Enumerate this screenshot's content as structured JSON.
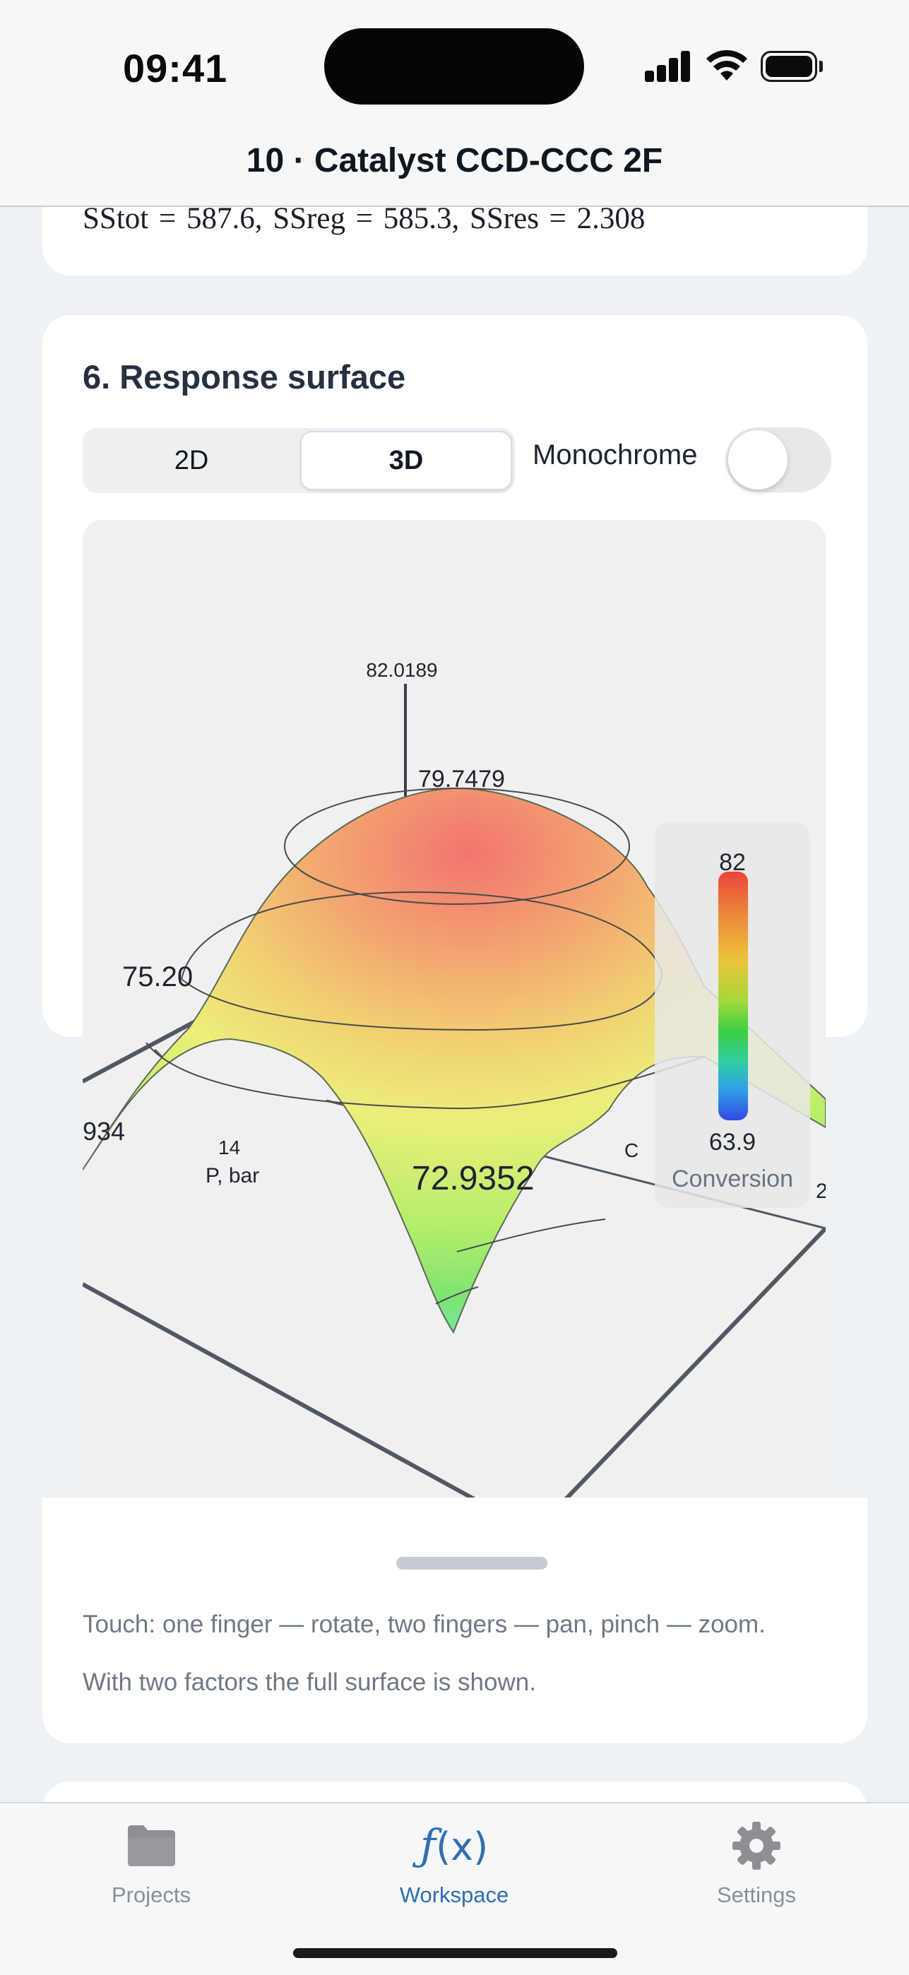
{
  "status_bar": {
    "time": "09:41"
  },
  "nav": {
    "title": "10 · Catalyst CCD-CCC 2F"
  },
  "previous_card": {
    "ss_line": "SStot = 587.6,  SSreg = 585.3,  SSres = 2.308"
  },
  "response_surface": {
    "title": "6. Response surface",
    "segments": [
      "2D",
      "3D"
    ],
    "selected_segment": "3D",
    "monochrome_label": "Monochrome",
    "monochrome_on": false,
    "axis_labels": {
      "z_top": "82.0189",
      "z_mid": "79.7479",
      "z_side": "75.20",
      "x_left": "934",
      "p_tick": "14",
      "p_axis": "P, bar",
      "center_value": "72.9352",
      "c_label": "C",
      "right_edge": "2"
    },
    "legend": {
      "max": "82",
      "min": "63.9",
      "title": "Conversion"
    },
    "hints": [
      "Touch: one finger — rotate, two fingers — pan, pinch — zoom.",
      "With two factors the full surface is shown."
    ]
  },
  "tabs": [
    {
      "label": "Projects",
      "icon": "folder-icon"
    },
    {
      "label": "Workspace",
      "icon": "fx-icon"
    },
    {
      "label": "Settings",
      "icon": "gear-icon"
    }
  ],
  "active_tab": "Workspace",
  "colors": {
    "accent": "#2d6fb0",
    "surface_top": "#f07a74",
    "surface_mid": "#eef07a",
    "surface_low": "#7ae05a",
    "surface_bottom": "#6af0c0"
  }
}
